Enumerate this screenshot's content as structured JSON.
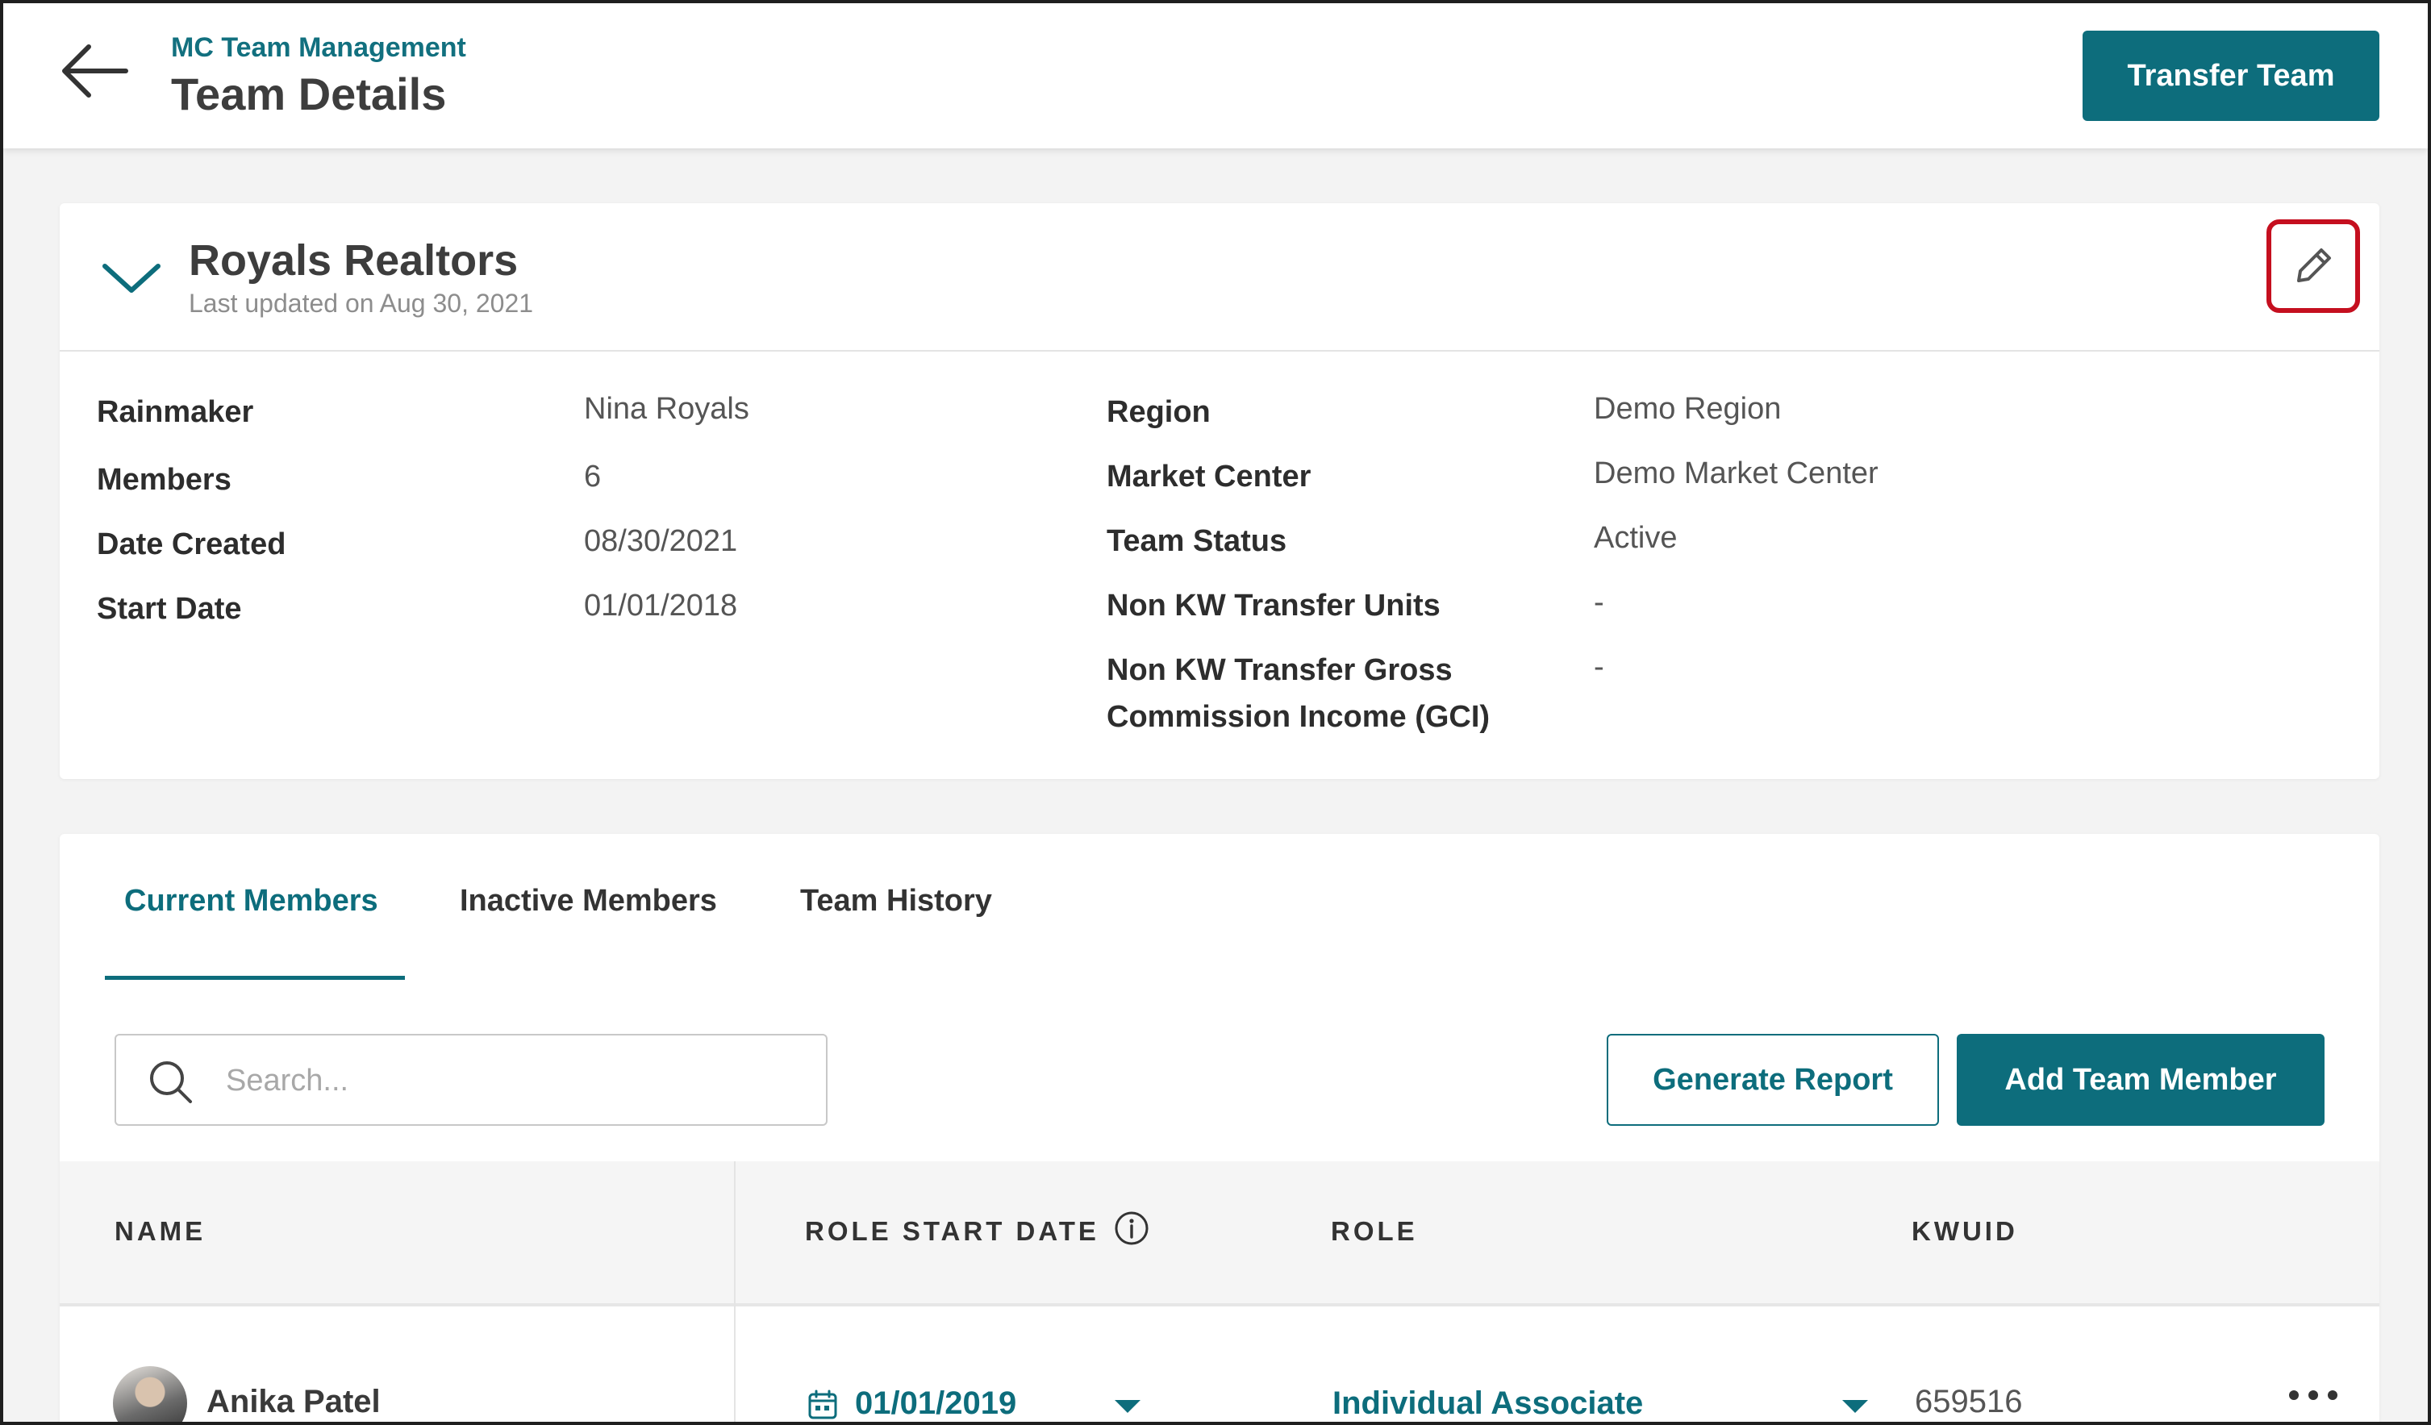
{
  "header": {
    "breadcrumb": "MC Team Management",
    "title": "Team Details",
    "transfer_label": "Transfer Team"
  },
  "team": {
    "name": "Royals Realtors",
    "last_updated": "Last updated on Aug 30, 2021",
    "details_left": [
      {
        "label": "Rainmaker",
        "value": "Nina Royals"
      },
      {
        "label": "Members",
        "value": "6"
      },
      {
        "label": "Date Created",
        "value": "08/30/2021"
      },
      {
        "label": "Start Date",
        "value": "01/01/2018"
      }
    ],
    "details_right": [
      {
        "label": "Region",
        "value": "Demo Region"
      },
      {
        "label": "Market Center",
        "value": "Demo Market Center"
      },
      {
        "label": "Team Status",
        "value": "Active"
      },
      {
        "label": "Non KW Transfer Units",
        "value": "-"
      },
      {
        "label": "Non KW Transfer Gross Commission Income (GCI)",
        "value": "-"
      }
    ]
  },
  "tabs": [
    {
      "label": "Current Members",
      "active": true
    },
    {
      "label": "Inactive Members",
      "active": false
    },
    {
      "label": "Team History",
      "active": false
    }
  ],
  "search": {
    "placeholder": "Search..."
  },
  "actions": {
    "generate_report": "Generate Report",
    "add_member": "Add Team Member"
  },
  "table": {
    "columns": [
      "NAME",
      "ROLE START DATE",
      "ROLE",
      "KWUID"
    ],
    "rows": [
      {
        "name": "Anika Patel",
        "role_start_date": "01/01/2019",
        "role": "Individual Associate",
        "kwuid": "659516"
      }
    ]
  },
  "colors": {
    "accent": "#0d6d7c",
    "highlight": "#c50f1f"
  },
  "icons": [
    "back-arrow-icon",
    "chevron-down-icon",
    "pencil-icon",
    "search-icon",
    "info-icon",
    "calendar-icon",
    "caret-down-icon",
    "more-horizontal-icon"
  ]
}
